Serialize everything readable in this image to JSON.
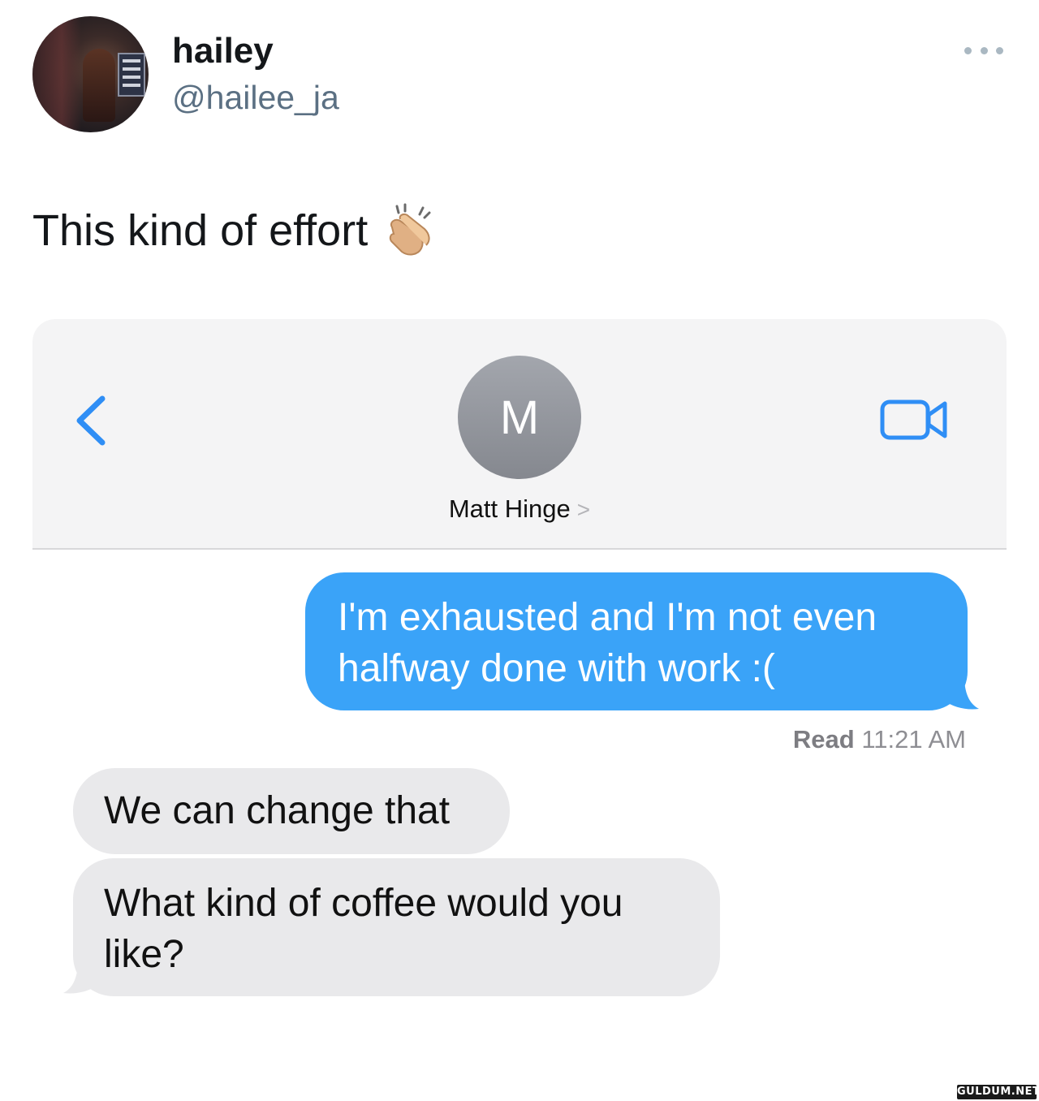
{
  "tweet": {
    "display_name": "hailey",
    "handle": "@hailee_ja",
    "text": "This kind of effort",
    "emoji_icon": "clapping-hands-icon",
    "more_icon": "ellipsis-icon"
  },
  "messages_screen": {
    "contact": {
      "initial": "M",
      "name": "Matt Hinge",
      "chevron": ">"
    },
    "back_icon": "chevron-left-icon",
    "video_icon": "video-camera-icon",
    "accent_color": "#3aa3f8",
    "sent_messages": [
      {
        "text": "I'm exhausted and I'm not even halfway done with work :("
      }
    ],
    "read_receipt": {
      "label": "Read",
      "time": "11:21 AM"
    },
    "received_messages": [
      {
        "text": "We can change that"
      },
      {
        "text": "What kind of coffee would you like?"
      }
    ]
  },
  "watermark": "GULDUM.NET"
}
